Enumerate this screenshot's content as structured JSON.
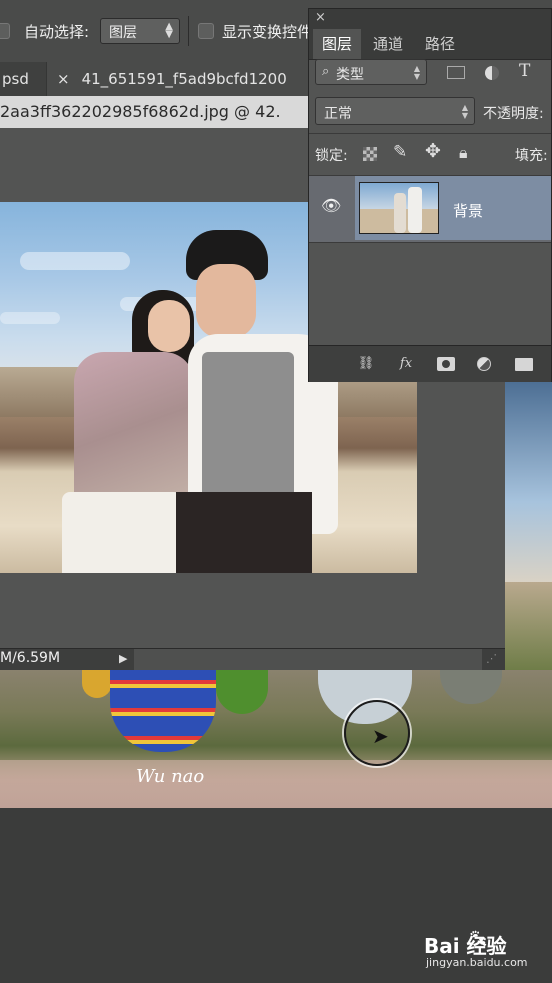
{
  "options_bar": {
    "auto_select_label": "自动选择:",
    "auto_select_value": "图层",
    "show_transform_label": "显示变换控件"
  },
  "tabs": [
    {
      "label": "psd"
    },
    {
      "label": "41_651591_f5ad9bcfd1200"
    }
  ],
  "tab_close_glyph": "×",
  "document": {
    "title": "2aa3ff362202985f6862d.jpg @ 42.",
    "status": "M/6.59M",
    "overlay_text": "Wu nao"
  },
  "layers_panel": {
    "close_glyph": "×",
    "tabs": [
      "图层",
      "通道",
      "路径"
    ],
    "active_tab": 0,
    "filter_label": "类型",
    "blend_mode": "正常",
    "opacity_label": "不透明度:",
    "lock_label": "锁定:",
    "fill_label": "填充:",
    "layers": [
      {
        "name": "背景",
        "visible": true,
        "selected": true
      }
    ],
    "footer_icons": [
      "link-icon",
      "fx-icon",
      "mask-icon",
      "adjustment-icon",
      "folder-icon"
    ]
  },
  "watermark": {
    "brand": "Bai  经验",
    "url": "jingyan.baidu.com"
  }
}
